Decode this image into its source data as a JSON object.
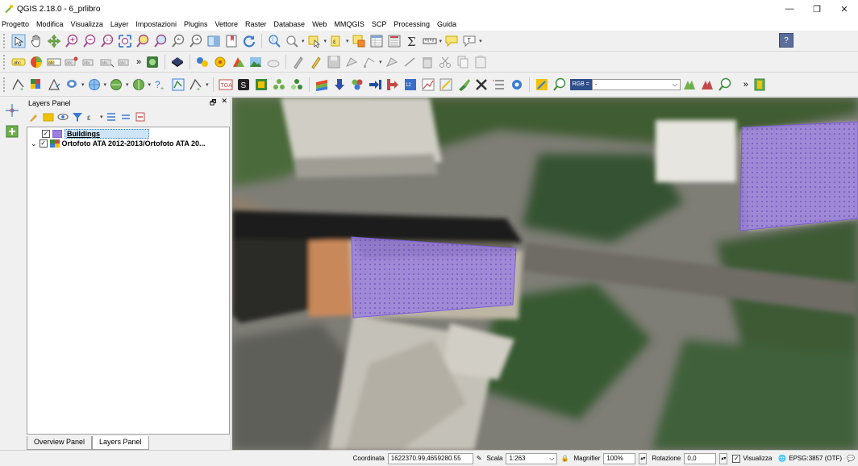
{
  "window": {
    "title": "QGIS 2.18.0 - 6_prlibro",
    "controls": [
      "—",
      "❐",
      "✕"
    ]
  },
  "menu": [
    "Progetto",
    "Modifica",
    "Visualizza",
    "Layer",
    "Impostazioni",
    "Plugins",
    "Vettore",
    "Raster",
    "Database",
    "Web",
    "MMQGIS",
    "SCP",
    "Processing",
    "Guida"
  ],
  "toolbar3": {
    "toa_label": "TOA",
    "rgb_label": "RGB =",
    "rgb_value": "-"
  },
  "help_button": "?",
  "layers_panel": {
    "title": "Layers Panel",
    "layers": [
      {
        "name": "Buildings",
        "checked": true,
        "selected": true
      },
      {
        "name": "Ortofoto ATA 2012-2013/Ortofoto ATA 20...",
        "checked": true,
        "selected": false
      }
    ],
    "tabs": [
      "Overview Panel",
      "Layers Panel"
    ]
  },
  "status": {
    "coord_label": "Coordinata",
    "coord_value": "1622370.99,4659280.55",
    "scale_label": "Scala",
    "scale_value": "1:263",
    "magnifier_label": "Magnifier",
    "magnifier_value": "100%",
    "rotation_label": "Rotazione",
    "rotation_value": "0,0",
    "render_label": "Visualizza",
    "crs_label": "EPSG:3857 (OTF)"
  },
  "colors": {
    "polygon_fill": "#9a7fe0",
    "selection": "#cde4f7"
  }
}
